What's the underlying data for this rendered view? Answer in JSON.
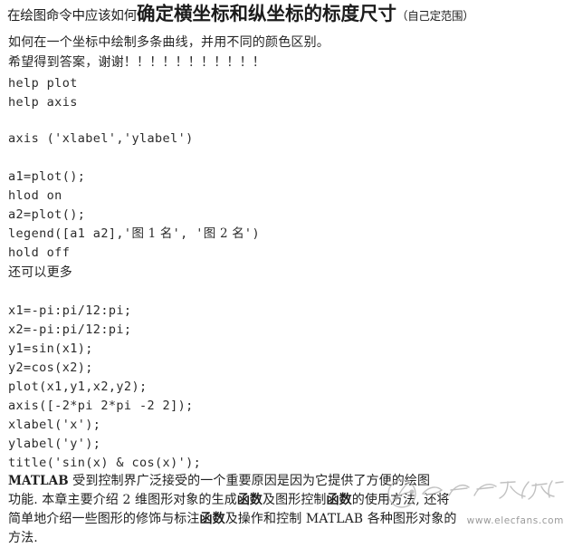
{
  "document": {
    "heading": {
      "lead": "在绘图命令中应该如何",
      "strong": "确定横坐标和纵坐标的标度尺寸",
      "paren": "（自己定范围）"
    },
    "intro_lines": [
      "如何在一个坐标中绘制多条曲线，并用不同的颜色区别。",
      "希望得到答案，谢谢！！！！！！！！！！！"
    ],
    "code_block_1": [
      "help plot",
      "help axis"
    ],
    "code_block_2": [
      "axis ('xlabel','ylabel')"
    ],
    "code_block_3": [
      "a1=plot();",
      "hlod on",
      "a2=plot();"
    ],
    "legend_line": {
      "prefix": "legend([a1 a2],'",
      "name1": "图 1 名",
      "middle": "', '",
      "name2": "图 2 名",
      "suffix": "')"
    },
    "code_block_4": [
      "hold off"
    ],
    "note_line": "还可以更多",
    "code_block_5": [
      "x1=-pi:pi/12:pi;",
      "x2=-pi:pi/12:pi;",
      "y1=sin(x1);",
      "y2=cos(x2);",
      "plot(x1,y1,x2,y2);",
      "axis([-2*pi 2*pi -2 2]);",
      "xlabel('x');",
      "ylabel('y');",
      "title('sin(x) & cos(x)');"
    ],
    "paragraph": {
      "line1_a": "MATLAB",
      "line1_b": " 受到控制界广泛接受的一个重要原因是因为它提供了方便的绘图",
      "line2_a": "功能. 本章主要介绍 2 维图形对象的生成",
      "line2_bold1": "函数",
      "line2_b": "及图形控制",
      "line2_bold2": "函数",
      "line2_c": "的使用方法, 还将",
      "line3_a": "简单地介绍一些图形的修饰与标注",
      "line3_bold1": "函数",
      "line3_b": "及操作和控制 MATLAB 各种图形对象的",
      "line3_c": "方法",
      "line4": "方法."
    }
  },
  "watermark": {
    "url": "www.elecfans.com",
    "logo_name": "elecfans-logo-watermark",
    "color": "#a8a8a8"
  }
}
